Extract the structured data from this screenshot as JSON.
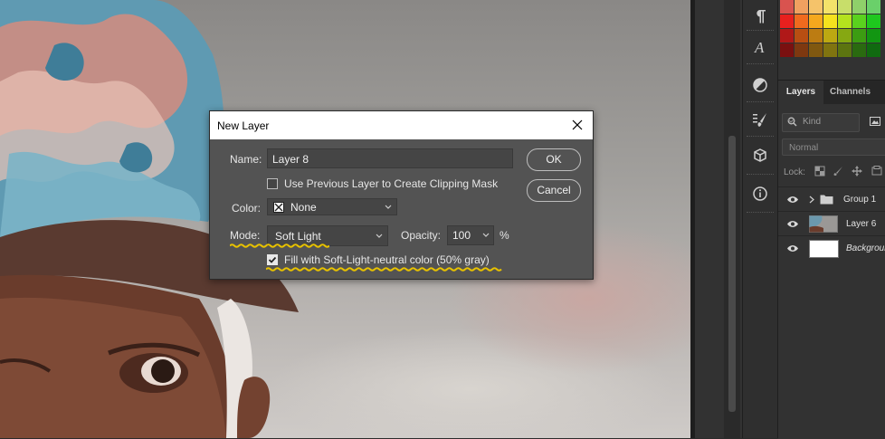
{
  "dialog": {
    "title": "New Layer",
    "name_label": "Name:",
    "name_value": "Layer 8",
    "clipping_mask_label": "Use Previous Layer to Create Clipping Mask",
    "clipping_mask_checked": false,
    "color_label": "Color:",
    "color_value": "None",
    "mode_label": "Mode:",
    "mode_value": "Soft Light",
    "opacity_label": "Opacity:",
    "opacity_value": "100",
    "opacity_unit": "%",
    "fill_neutral_label": "Fill with Soft-Light-neutral color (50% gray)",
    "fill_neutral_checked": true,
    "ok_label": "OK",
    "cancel_label": "Cancel",
    "highlight_color": "#e8c200"
  },
  "tool_column": {
    "icons": [
      "paragraph-icon",
      "character-icon",
      "adjustments-icon",
      "brush-settings-icon",
      "3d-icon",
      "info-icon"
    ]
  },
  "layers_panel": {
    "tabs": [
      "Layers",
      "Channels"
    ],
    "active_tab": "Layers",
    "kind_filter": "Kind",
    "blend_mode": "Normal",
    "lock_label": "Lock:",
    "layers": [
      {
        "name": "Group 1",
        "type": "group",
        "visible": true
      },
      {
        "name": "Layer 6",
        "type": "pixel",
        "visible": true
      },
      {
        "name": "Background",
        "type": "background",
        "visible": true
      }
    ]
  },
  "swatches": {
    "rows": [
      [
        "#d9534f",
        "#f0a060",
        "#f5c36a",
        "#f3e26a",
        "#c8de6a",
        "#8fd06a",
        "#6ad06a"
      ],
      [
        "#e8201e",
        "#f06a1e",
        "#f5a81e",
        "#f5e21e",
        "#b4e21e",
        "#5ad21e",
        "#1ec81e"
      ],
      [
        "#b01818",
        "#b84e12",
        "#bc7c12",
        "#bca812",
        "#86a812",
        "#3c9c12",
        "#129612"
      ],
      [
        "#7a1010",
        "#7e3810",
        "#805810",
        "#807410",
        "#5c7410",
        "#2a6a10",
        "#106a10"
      ]
    ]
  }
}
